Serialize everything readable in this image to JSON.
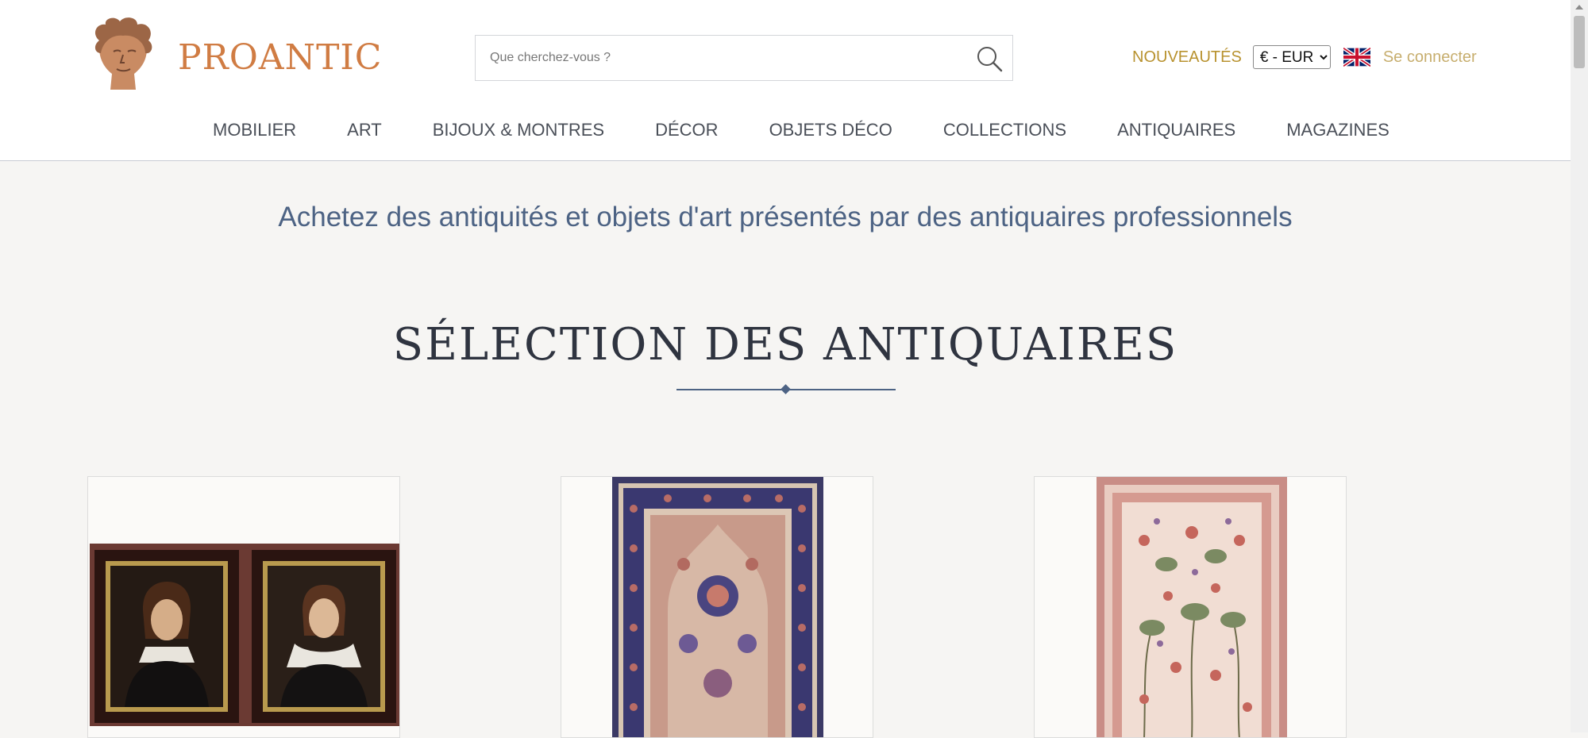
{
  "header": {
    "logo_text": "PROANTIC",
    "search": {
      "placeholder": "Que cherchez-vous ?"
    },
    "new_arrivals": "NOUVEAUTÉS",
    "currency": {
      "selected": "€ - EUR"
    },
    "language_flag": "uk-flag-icon",
    "login": "Se connecter"
  },
  "nav": {
    "items": [
      {
        "label": "MOBILIER"
      },
      {
        "label": "ART"
      },
      {
        "label": "BIJOUX & MONTRES"
      },
      {
        "label": "DÉCOR"
      },
      {
        "label": "OBJETS DÉCO"
      },
      {
        "label": "COLLECTIONS"
      },
      {
        "label": "ANTIQUAIRES"
      },
      {
        "label": "MAGAZINES"
      }
    ]
  },
  "main": {
    "tagline": "Achetez des antiquités et objets d'art présentés par des antiquaires professionnels",
    "section_title": "SÉLECTION DES ANTIQUAIRES",
    "products": [
      {
        "image": "portrait-pair-image"
      },
      {
        "image": "persian-rug-image"
      },
      {
        "image": "floral-rug-image"
      }
    ]
  },
  "colors": {
    "logo": "#d07c43",
    "accent_gold": "#b8922f",
    "login_gold": "#c7ae6e",
    "tagline_blue": "#4d6384",
    "nav_text": "#4a4f58",
    "background": "#f6f5f3"
  }
}
